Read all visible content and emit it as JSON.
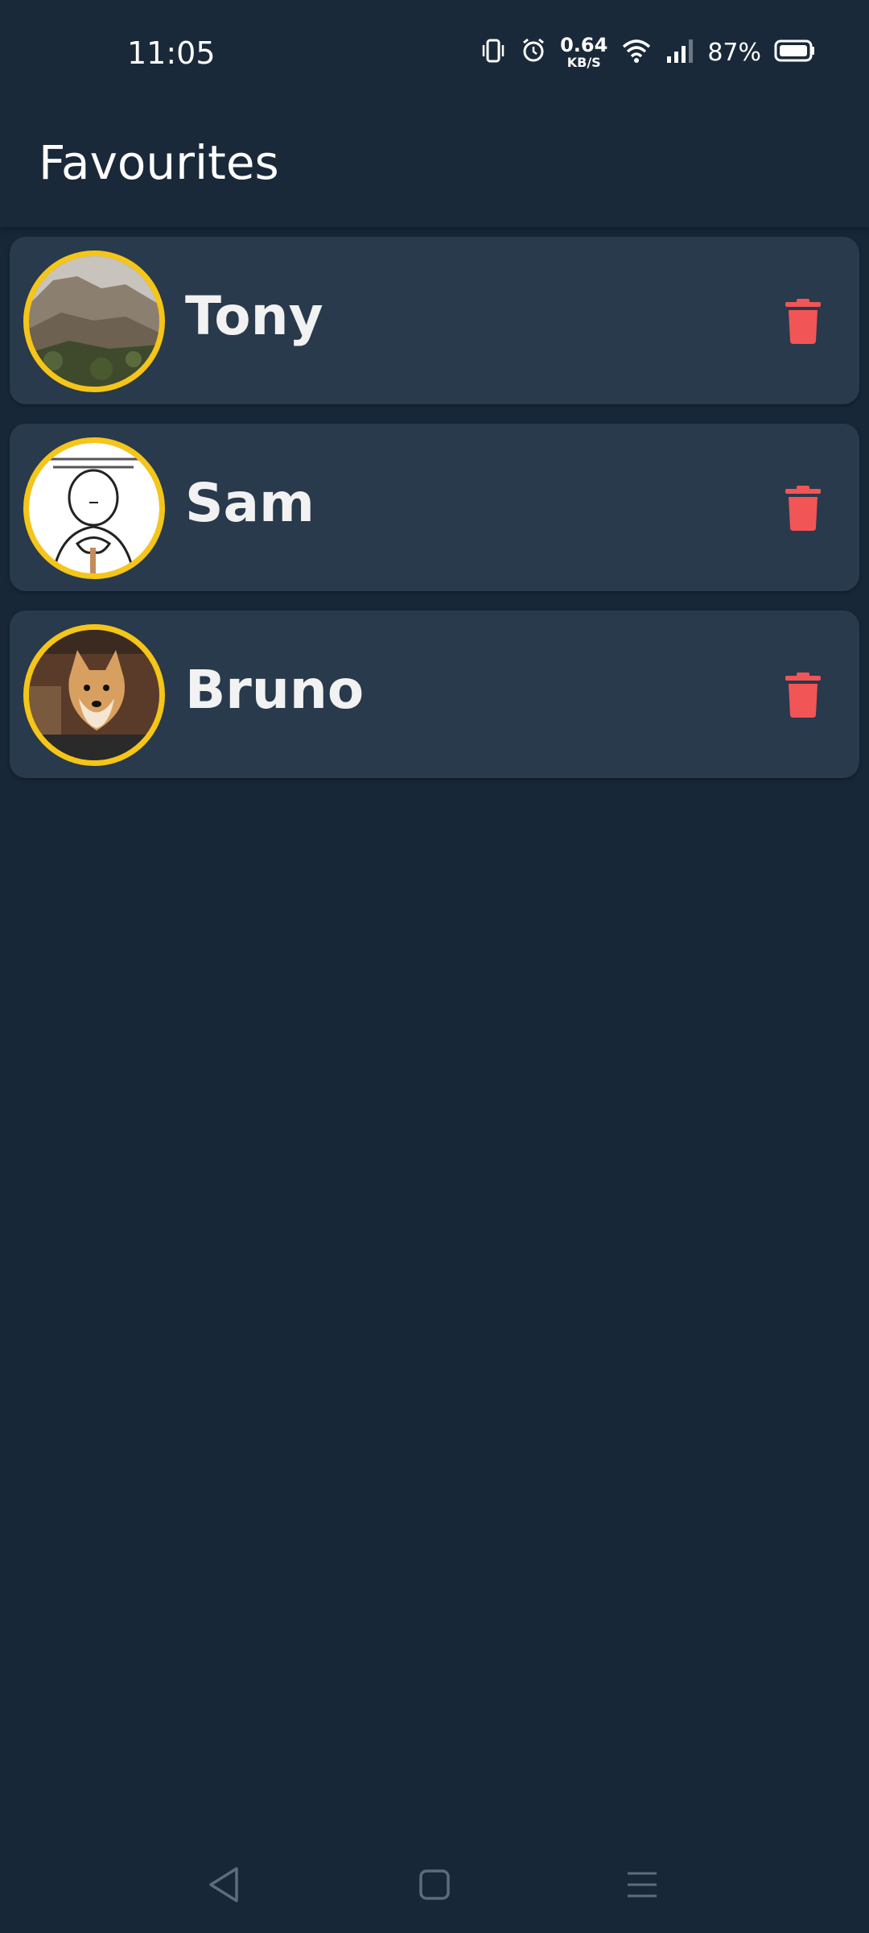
{
  "status_bar": {
    "time": "11:05",
    "net_speed_value": "0.64",
    "net_speed_unit": "KB/S",
    "battery_percent": "87%",
    "icons": [
      "vibrate-icon",
      "alarm-icon",
      "wifi-icon",
      "signal-icon",
      "battery-icon"
    ]
  },
  "app_bar": {
    "title": "Favourites"
  },
  "favourites": [
    {
      "name": "Tony",
      "avatar": "rocky-hill-photo"
    },
    {
      "name": "Sam",
      "avatar": "cartoon-sketch"
    },
    {
      "name": "Bruno",
      "avatar": "shiba-dog-photo"
    }
  ],
  "nav_bar": {
    "icons": [
      "back-icon",
      "home-icon",
      "recents-icon"
    ]
  },
  "colors": {
    "background": "#172738",
    "card": "#283a4c",
    "avatar_border": "#f5c518",
    "delete": "#f25555"
  }
}
